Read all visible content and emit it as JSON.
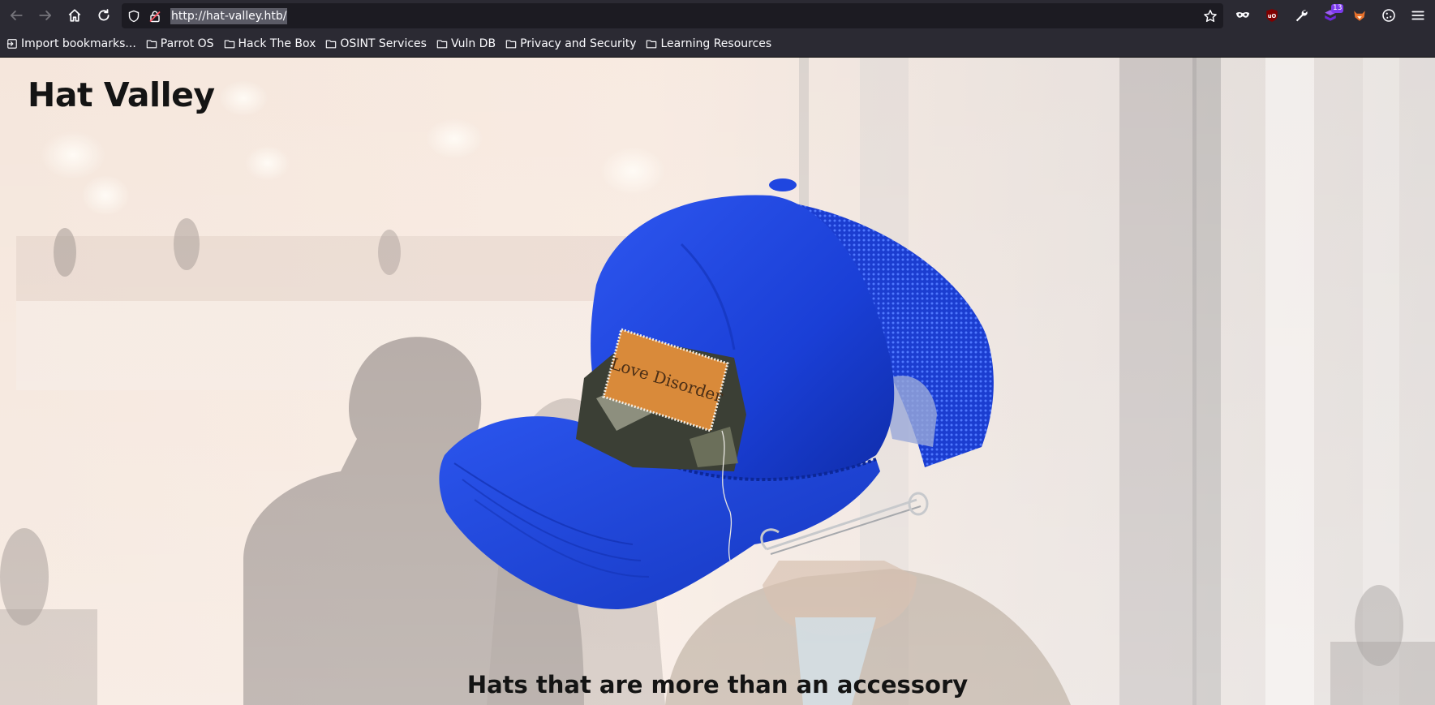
{
  "browser": {
    "url": "http://hat-valley.htb/",
    "extension_badge_count": "13",
    "icons": [
      "back-arrow-icon",
      "forward-arrow-icon",
      "home-icon",
      "reload-icon",
      "shield-icon",
      "lock-icon",
      "star-icon",
      "mask-icon",
      "ublock-icon",
      "wrench-icon",
      "wappalyzer-icon",
      "foxyproxy-icon",
      "cookie-icon",
      "hamburger-menu-icon"
    ]
  },
  "bookmarks": [
    {
      "label": "Import bookmarks...",
      "icon": "import-icon"
    },
    {
      "label": "Parrot OS",
      "icon": "folder-icon"
    },
    {
      "label": "Hack The Box",
      "icon": "folder-icon"
    },
    {
      "label": "OSINT Services",
      "icon": "folder-icon"
    },
    {
      "label": "Vuln DB",
      "icon": "folder-icon"
    },
    {
      "label": "Privacy and Security",
      "icon": "folder-icon"
    },
    {
      "label": "Learning Resources",
      "icon": "folder-icon"
    }
  ],
  "site": {
    "title": "Hat Valley",
    "tagline": "Hats that are more than an accessory",
    "patch_text": "Love Disorder"
  },
  "colors": {
    "toolbar": "#2b2a33",
    "urlbar": "#1c1b22",
    "cap_blue": "#1a3fd6",
    "patch_orange": "#d98a3a"
  }
}
